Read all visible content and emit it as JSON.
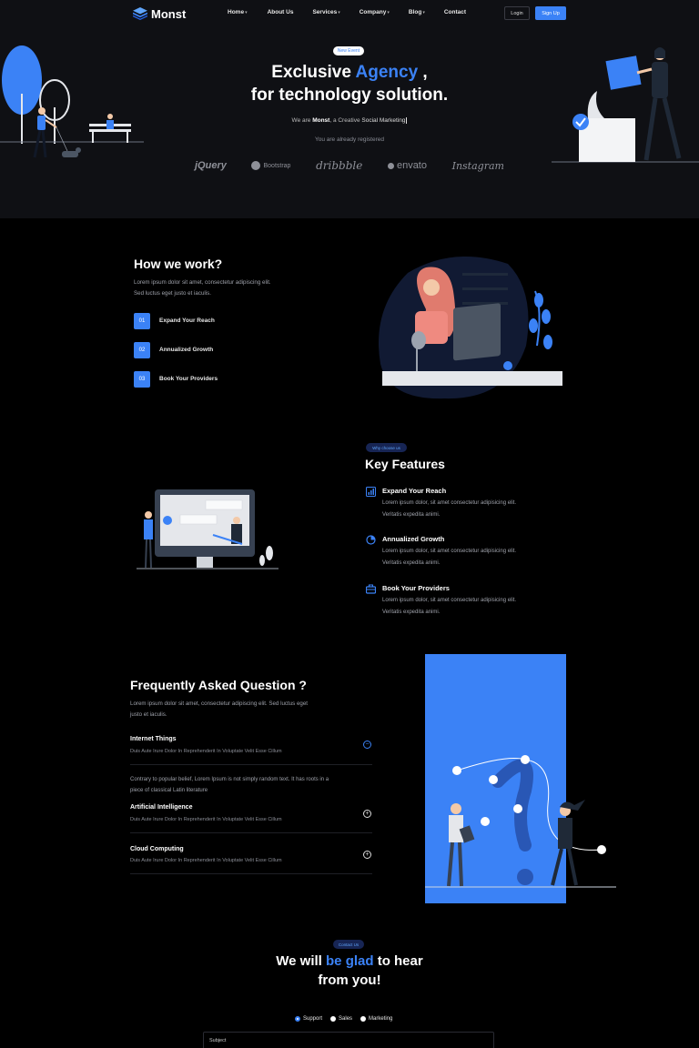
{
  "nav": {
    "logo_text": "Monst",
    "items": [
      {
        "label": "Home",
        "caret": "▾"
      },
      {
        "label": "About Us",
        "caret": ""
      },
      {
        "label": "Services",
        "caret": "▾"
      },
      {
        "label": "Company",
        "caret": "▾"
      },
      {
        "label": "Blog",
        "caret": "▾"
      },
      {
        "label": "Contact",
        "caret": ""
      }
    ],
    "login_label": "Login",
    "signup_label": "Sign Up"
  },
  "hero": {
    "badge": "New Event",
    "title_part1": "Exclusive ",
    "title_highlight": "Agency",
    "title_part2": " ,",
    "title_line2": "for technology solution.",
    "sub_prefix": "We are ",
    "sub_brand": "Monst",
    "sub_middle": ", a Creative ",
    "sub_suffix": "Social Marketing",
    "registered": "You are already registered",
    "brands": [
      "jQuery",
      "Bootstrap",
      "dribbble",
      "envato",
      "Instagram"
    ]
  },
  "how_we_work": {
    "title": "How we work?",
    "description_line1": "Lorem ipsum dolor sit amet, consectetur adipiscing elit.",
    "description_line2": "Sed luctus eget justo et iaculis.",
    "steps": [
      {
        "num": "01",
        "label": "Expand Your Reach"
      },
      {
        "num": "02",
        "label": "Annualized Growth"
      },
      {
        "num": "03",
        "label": "Book Your Providers"
      }
    ]
  },
  "features": {
    "badge": "Why choose us",
    "title": "Key Features",
    "items": [
      {
        "title": "Expand Your Reach",
        "line1": "Lorem ipsum dolor, sit amet consectetur adipisicing elit.",
        "line2": "Veritatis expedita animi."
      },
      {
        "title": "Annualized Growth",
        "line1": "Lorem ipsum dolor, sit amet consectetur adipisicing elit.",
        "line2": "Veritatis expedita animi."
      },
      {
        "title": "Book Your Providers",
        "line1": "Lorem ipsum dolor, sit amet consectetur adipisicing elit.",
        "line2": "Veritatis expedita animi."
      }
    ],
    "icons": [
      "bar-chart-icon",
      "pie-chart-icon",
      "briefcase-icon"
    ]
  },
  "faq": {
    "title": "Frequently Asked Question ?",
    "description_line1": "Lorem ipsum dolor sit amet, consectetur adipiscing elit. Sed luctus eget",
    "description_line2": "justo et iaculis.",
    "items": [
      {
        "title": "Internet Things",
        "desc": "Duis Aute Irure Dolor In Reprehenderit In Voluptate Velit Esse Cillum",
        "toggle": "−",
        "open": true
      },
      {
        "title": "Artificial Intelligence",
        "desc": "Duis Aute Irure Dolor In Reprehenderit In Voluptate Velit Esse Cillum",
        "toggle": "+",
        "open": false
      },
      {
        "title": "Cloud Computing",
        "desc": "Duis Aute Irure Dolor In Reprehenderit In Voluptate Velit Esse Cillum",
        "toggle": "+",
        "open": false
      }
    ],
    "answer_line1": "Contrary to popular belief, Lorem Ipsum is not simply random text. It has roots in a",
    "answer_line2": "piece of classical Latin literature"
  },
  "contact": {
    "badge": "Contact Us",
    "title_part1": "We will ",
    "title_highlight": "be glad",
    "title_part2": " to hear",
    "title_line2": "from you!",
    "options": [
      "Support",
      "Sales",
      "Marketing"
    ],
    "selected_option": "Support",
    "subject_placeholder": "Subject"
  },
  "colors": {
    "accent": "#3b82f6",
    "background": "#000000",
    "hero_background": "#0f1014"
  }
}
